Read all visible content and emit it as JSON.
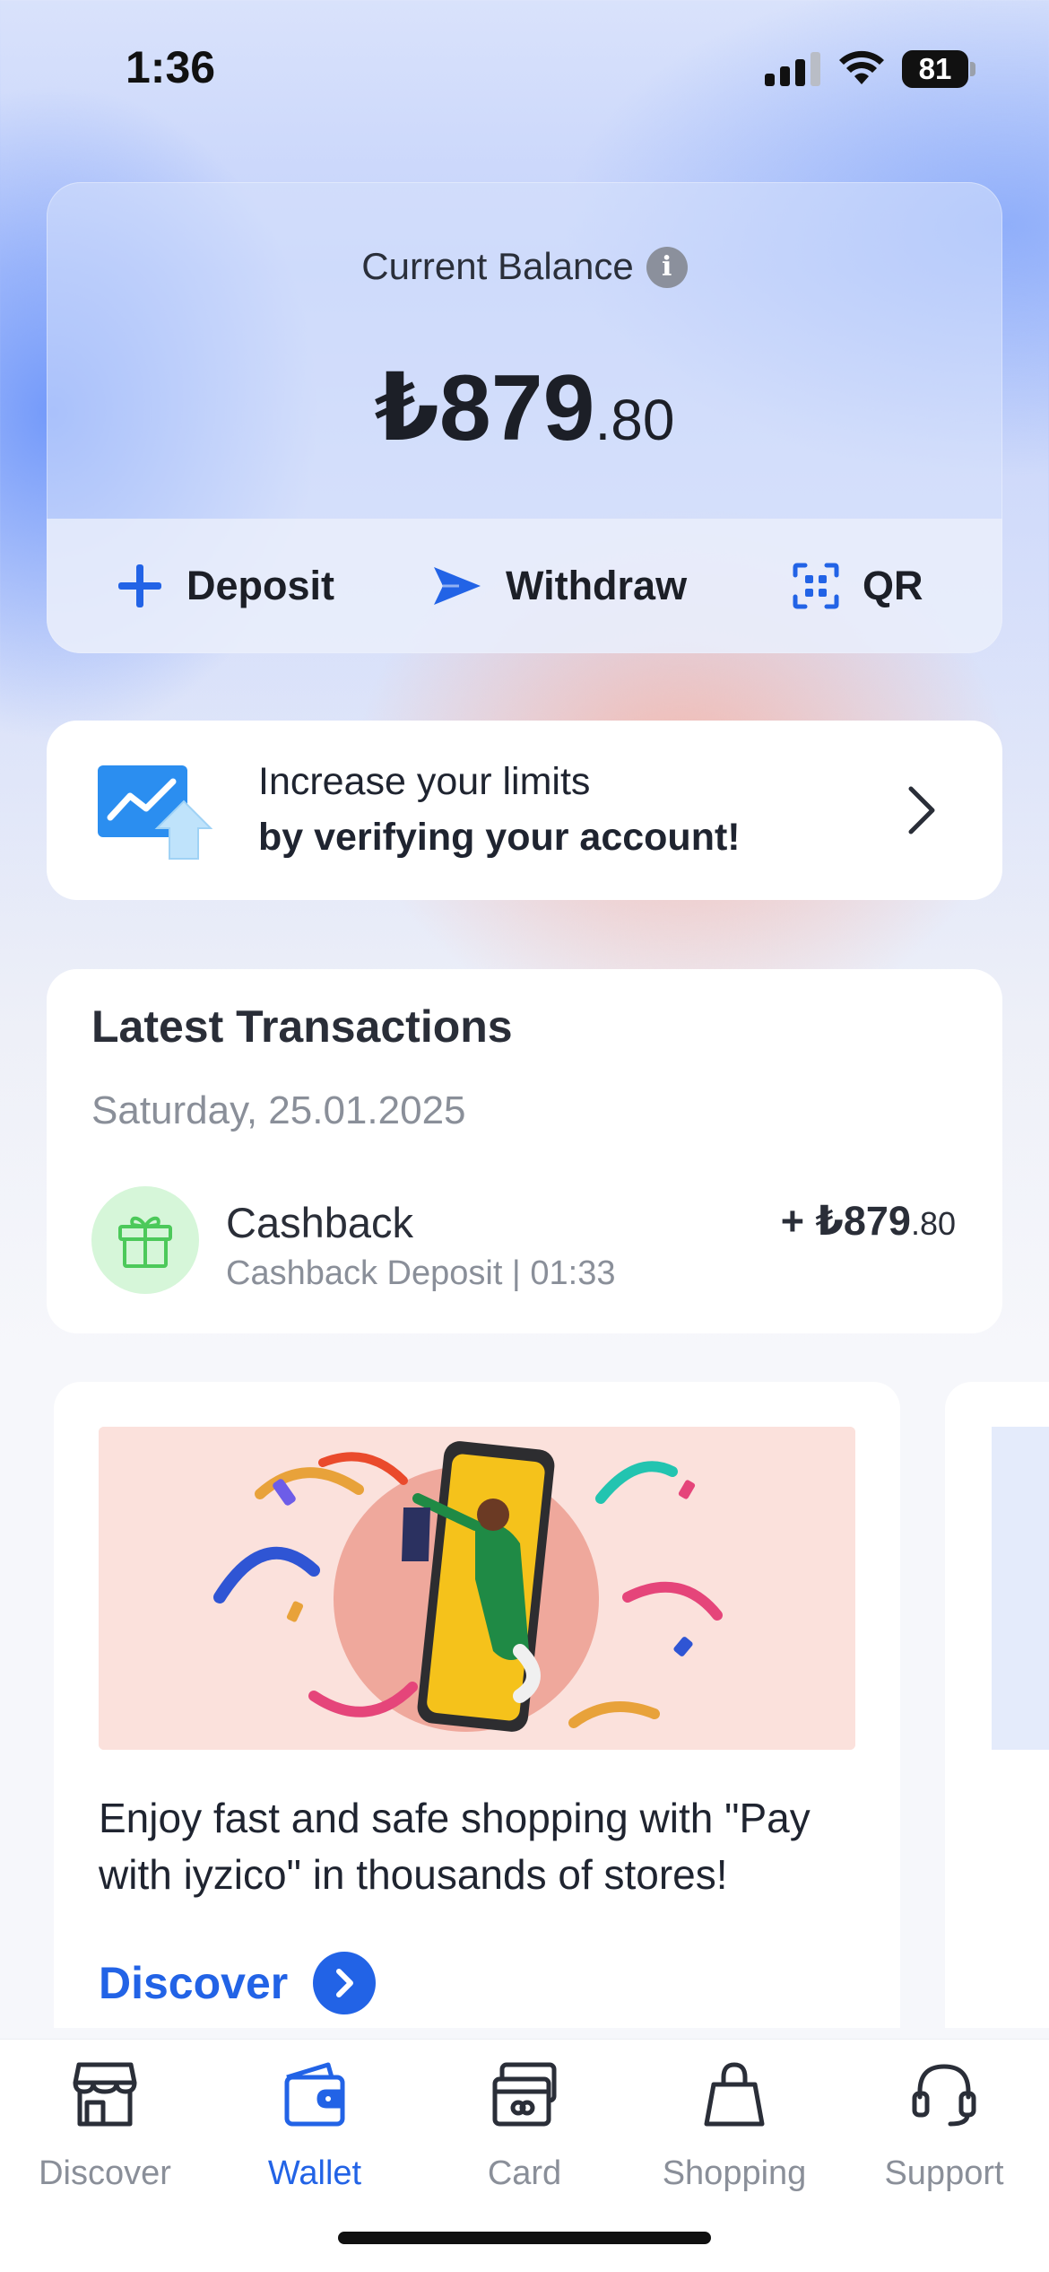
{
  "status_bar": {
    "time": "1:36",
    "battery": "81",
    "icons": [
      "signal-icon",
      "wifi-icon",
      "battery-icon"
    ]
  },
  "balance": {
    "title": "Current Balance",
    "info_icon": "info-icon",
    "currency": "₺",
    "amount_major": "₺879",
    "amount_minor": ".80",
    "actions": [
      {
        "label": "Deposit",
        "icon": "plus-icon"
      },
      {
        "label": "Withdraw",
        "icon": "send-icon"
      },
      {
        "label": "QR",
        "icon": "qr-icon"
      }
    ]
  },
  "verify": {
    "line1": "Increase your limits",
    "line2": "by verifying your account!",
    "icon": "limit-increase-illustration"
  },
  "transactions": {
    "title": "Latest Transactions",
    "date": "Saturday, 25.01.2025",
    "items": [
      {
        "icon": "gift-icon",
        "name": "Cashback",
        "subtitle": "Cashback Deposit | 01:33",
        "amount_major": "+ ₺879",
        "amount_minor": ".80"
      }
    ]
  },
  "promo": {
    "text": "Enjoy fast and safe shopping with \"Pay with iyzico\" in thousands of stores!",
    "link_label": "Discover",
    "link_icon": "chevron-right-icon"
  },
  "tab_bar": {
    "active": "Wallet",
    "tabs": [
      {
        "label": "Discover",
        "icon": "store-icon"
      },
      {
        "label": "Wallet",
        "icon": "wallet-icon"
      },
      {
        "label": "Card",
        "icon": "card-icon"
      },
      {
        "label": "Shopping",
        "icon": "shopping-bag-icon"
      },
      {
        "label": "Support",
        "icon": "headset-icon"
      }
    ]
  },
  "colors": {
    "accent": "#2263e6",
    "text": "#1f2430",
    "muted": "#8a8f99",
    "gift_bg": "#d6f6d9",
    "gift": "#4cc95a",
    "promo_bg": "#fbe1dc"
  }
}
